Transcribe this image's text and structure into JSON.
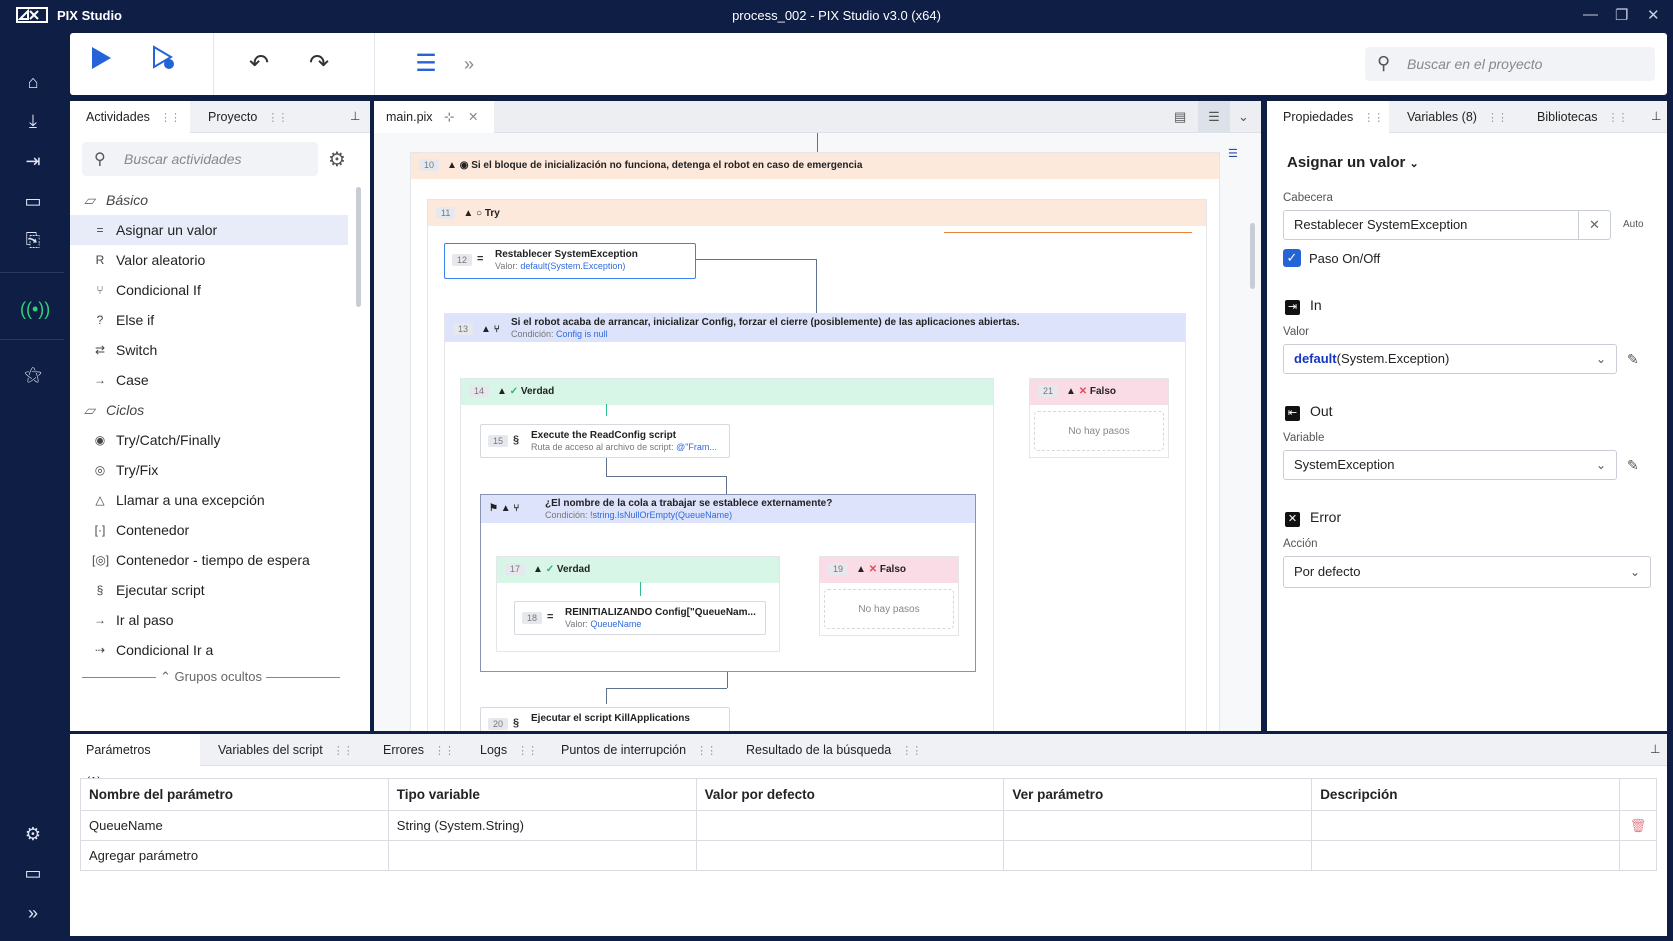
{
  "window": {
    "app_name": "PIX Studio",
    "title": "process_002 - PIX Studio v3.0 (x64)",
    "minimize": "—",
    "maximize": "❐",
    "close": "✕"
  },
  "toolbar": {
    "search_placeholder": "Buscar en el proyecto"
  },
  "activities_panel": {
    "tabs": [
      {
        "label": "Actividades"
      },
      {
        "label": "Proyecto"
      }
    ],
    "search_placeholder": "Buscar actividades",
    "groups": [
      {
        "label": "Básico"
      },
      {
        "label": "Ciclos"
      }
    ],
    "items": [
      {
        "label": "Asignar un valor",
        "icon": "equals-icon",
        "glyph": "="
      },
      {
        "label": "Valor aleatorio",
        "icon": "random-icon",
        "glyph": "R"
      },
      {
        "label": "Condicional If",
        "icon": "branch-icon",
        "glyph": "⑂"
      },
      {
        "label": "Else if",
        "icon": "question-icon",
        "glyph": "?"
      },
      {
        "label": "Switch",
        "icon": "switch-icon",
        "glyph": "⇄"
      },
      {
        "label": "Case",
        "icon": "arrow-right-icon",
        "glyph": "→"
      },
      {
        "label": "Try/Catch/Finally",
        "icon": "target-icon",
        "glyph": "◉"
      },
      {
        "label": "Try/Fix",
        "icon": "fix-icon",
        "glyph": "◎"
      },
      {
        "label": "Llamar a una excepción",
        "icon": "warning-icon",
        "glyph": "△"
      },
      {
        "label": "Contenedor",
        "icon": "container-icon",
        "glyph": "[·]"
      },
      {
        "label": "Contenedor - tiempo de espera",
        "icon": "timer-container-icon",
        "glyph": "[◎]"
      },
      {
        "label": "Ejecutar script",
        "icon": "script-icon",
        "glyph": "§"
      },
      {
        "label": "Ir al paso",
        "icon": "goto-icon",
        "glyph": "→"
      },
      {
        "label": "Condicional Ir a",
        "icon": "conditional-goto-icon",
        "glyph": "⇢"
      }
    ],
    "hidden_groups": "Grupos ocultos"
  },
  "editor": {
    "tab_label": "main.pix",
    "blocks": {
      "b10": {
        "num": "10",
        "title": "Si el bloque de inicialización no funciona, detenga el robot en caso de emergencia"
      },
      "b11": {
        "num": "11",
        "title": "Try"
      },
      "b12": {
        "num": "12",
        "title": "Restablecer SystemException",
        "sub_label": "Valor:",
        "sub_value": "default(System.Exception)"
      },
      "b13": {
        "num": "13",
        "title": "Si el robot acaba de arrancar, inicializar Config, forzar el cierre (posiblemente) de las aplicaciones abiertas.",
        "sub_label": "Condición:",
        "sub_value": "Config is null"
      },
      "b14": {
        "num": "14",
        "title": "Verdad"
      },
      "b15": {
        "num": "15",
        "title": "Execute the ReadConfig script",
        "sub_label": "Ruta de acceso al archivo de script:",
        "sub_value": "@\"Fram..."
      },
      "b16": {
        "title": "¿El nombre de la cola a trabajar se establece externamente?",
        "sub_label": "Condición:",
        "sub_value": "!string.IsNullOrEmpty(QueueName)"
      },
      "b17": {
        "num": "17",
        "title": "Verdad"
      },
      "b18": {
        "num": "18",
        "title": "REINITIALIZANDO Config[\"QueueNam...",
        "sub_label": "Valor:",
        "sub_value": "QueueName"
      },
      "b19": {
        "num": "19",
        "title": "Falso",
        "empty": "No hay pasos"
      },
      "b20": {
        "num": "20",
        "title": "Ejecutar el script KillApplications"
      },
      "b21": {
        "num": "21",
        "title": "Falso",
        "empty": "No hay pasos"
      }
    }
  },
  "properties_panel": {
    "tabs": [
      {
        "label": "Propiedades"
      },
      {
        "label": "Variables (8)"
      },
      {
        "label": "Bibliotecas"
      }
    ],
    "activity_name": "Asignar un valor",
    "header_label": "Cabecera",
    "header_value": "Restablecer SystemException",
    "auto": "Auto",
    "step_toggle": "Paso On/Off",
    "in_label": "In",
    "value_label": "Valor",
    "value_keyword": "default",
    "value_rest": "(System.Exception)",
    "out_label": "Out",
    "variable_label": "Variable",
    "variable_value": "SystemException",
    "error_label": "Error",
    "action_label": "Acción",
    "action_value": "Por defecto"
  },
  "bottom_panel": {
    "tabs": [
      {
        "label": "Parámetros (1)"
      },
      {
        "label": "Variables del script"
      },
      {
        "label": "Errores"
      },
      {
        "label": "Logs"
      },
      {
        "label": "Puntos de interrupción"
      },
      {
        "label": "Resultado de la búsqueda"
      }
    ],
    "columns": [
      "Nombre del parámetro",
      "Tipo variable",
      "Valor por defecto",
      "Ver parámetro",
      "Descripción"
    ],
    "rows": [
      {
        "name": "QueueName",
        "type": "String (System.String)",
        "default": "",
        "view": "",
        "description": ""
      }
    ],
    "add_label": "Agregar parámetro"
  },
  "colors": {
    "frame": "#0f1e45",
    "accent": "#2563d8",
    "orange_block": "#fde8dc",
    "blue_block": "#dde3fa",
    "green_block": "#d7f6e8",
    "red_block": "#fadce6"
  }
}
